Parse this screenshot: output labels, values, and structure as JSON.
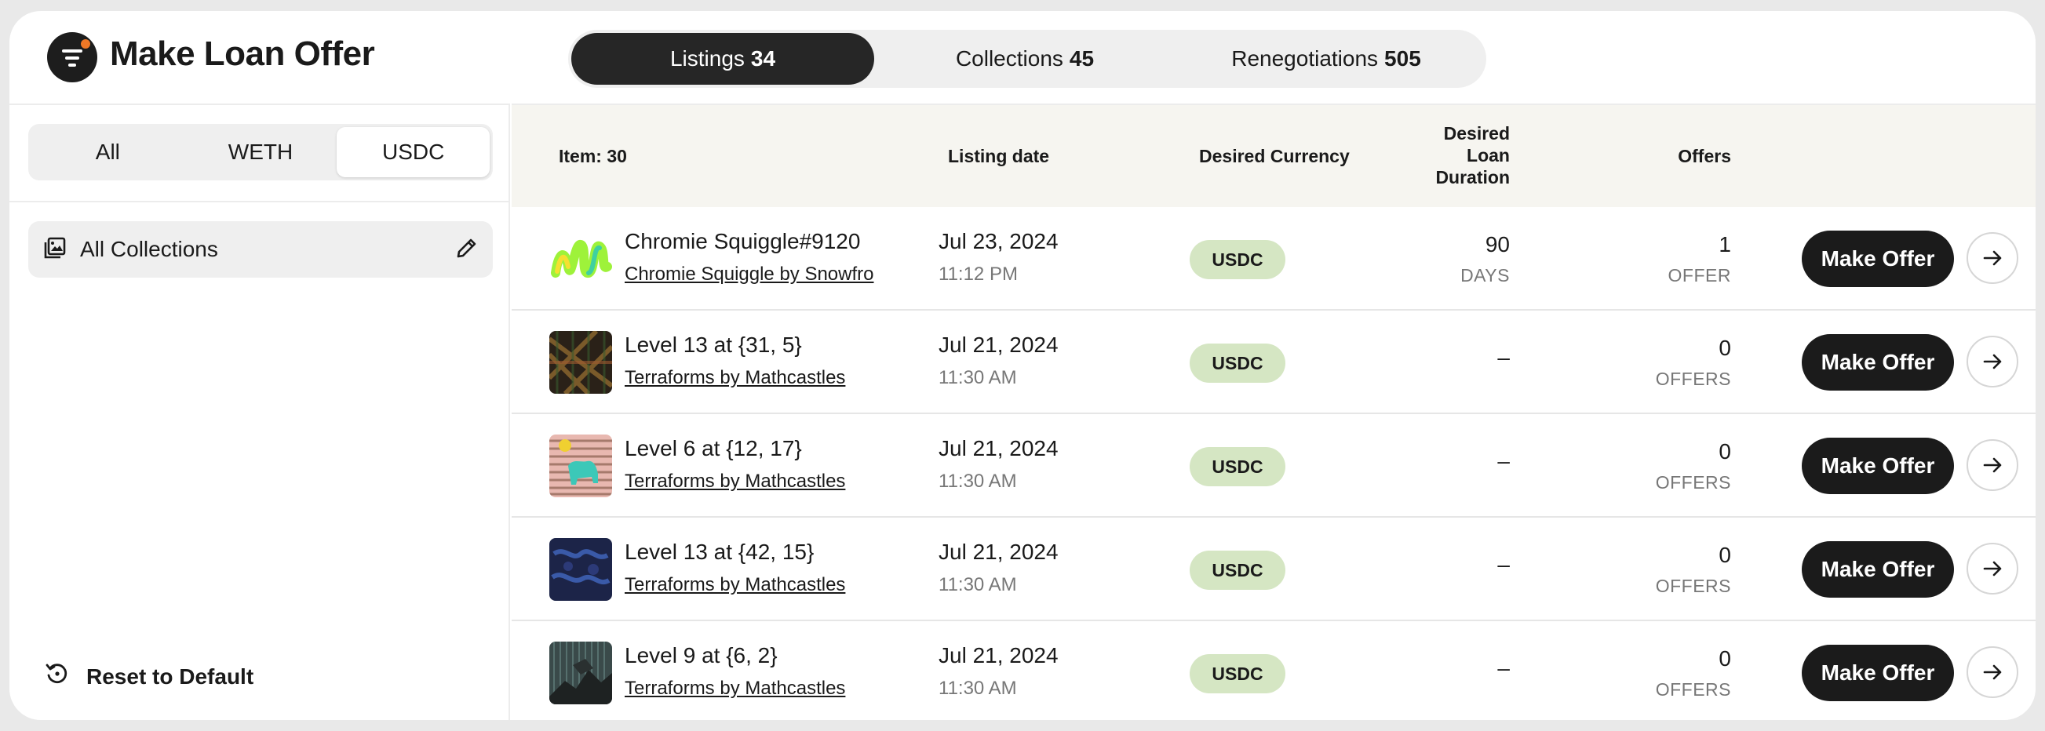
{
  "header": {
    "title": "Make Loan Offer",
    "logo_icon": "filter-icon",
    "accent": "#f07826",
    "tabs": [
      {
        "label": "Listings",
        "count": "34",
        "active": true
      },
      {
        "label": "Collections",
        "count": "45",
        "active": false
      },
      {
        "label": "Renegotiations",
        "count": "505",
        "active": false
      }
    ]
  },
  "sidebar": {
    "currency_filter": [
      "All",
      "WETH",
      "USDC"
    ],
    "currency_selected": "USDC",
    "collection_filter": {
      "label": "All Collections",
      "icon": "gallery-icon",
      "edit_icon": "pencil-icon"
    },
    "reset_label": "Reset to Default",
    "reset_icon": "history-icon"
  },
  "table": {
    "headers": {
      "item": "Item: 30",
      "listing_date": "Listing date",
      "currency": "Desired Currency",
      "duration_l1": "Desired",
      "duration_l2": "Loan",
      "duration_l3": "Duration",
      "offers": "Offers"
    },
    "rows": [
      {
        "name": "Chromie Squiggle#9120",
        "collection": "Chromie Squiggle by Snowfro",
        "date": "Jul 23, 2024",
        "time": "11:12 PM",
        "currency": "USDC",
        "duration": "90",
        "duration_unit": "DAYS",
        "offers": "1",
        "offers_unit": "OFFER",
        "action": "Make Offer"
      },
      {
        "name": "Level 13 at {31, 5}",
        "collection": "Terraforms by Mathcastles",
        "date": "Jul 21, 2024",
        "time": "11:30 AM",
        "currency": "USDC",
        "duration": "–",
        "offers": "0",
        "offers_unit": "OFFERS",
        "action": "Make Offer"
      },
      {
        "name": "Level 6 at {12, 17}",
        "collection": "Terraforms by Mathcastles",
        "date": "Jul 21, 2024",
        "time": "11:30 AM",
        "currency": "USDC",
        "duration": "–",
        "offers": "0",
        "offers_unit": "OFFERS",
        "action": "Make Offer"
      },
      {
        "name": "Level 13 at {42, 15}",
        "collection": "Terraforms by Mathcastles",
        "date": "Jul 21, 2024",
        "time": "11:30 AM",
        "currency": "USDC",
        "duration": "–",
        "offers": "0",
        "offers_unit": "OFFERS",
        "action": "Make Offer"
      },
      {
        "name": "Level 9 at {6, 2}",
        "collection": "Terraforms by Mathcastles",
        "date": "Jul 21, 2024",
        "time": "11:30 AM",
        "currency": "USDC",
        "duration": "–",
        "offers": "0",
        "offers_unit": "OFFERS",
        "action": "Make Offer"
      }
    ]
  }
}
